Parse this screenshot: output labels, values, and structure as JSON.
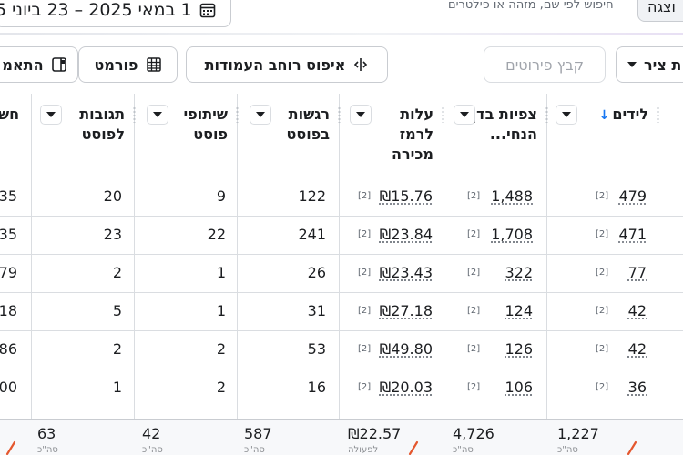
{
  "topbar": {
    "date_range": "1 במאי 2025 – 23 ביוני 5",
    "search_hint": "חיפוש לפי שם, מזהה או פילטרים",
    "display_label": "וצגה"
  },
  "toolbar": {
    "chart_label": "ת ציר",
    "breakdown_label": "קבץ פירוטים",
    "reset_columns_label": "איפוס רוחב העמודות",
    "format_label": "פורמט",
    "more_label": "התאמ"
  },
  "columns": [
    {
      "label": "לידים",
      "sorted": true
    },
    {
      "label": "צפיות בדף הנחי...",
      "sorted": false
    },
    {
      "label": "עלות לרמז מכירה",
      "sorted": false
    },
    {
      "label": "רגשות בפוסט",
      "sorted": false
    },
    {
      "label": "שיתופי פוסט",
      "sorted": false
    },
    {
      "label": "תגובות לפוסט",
      "sorted": false
    },
    {
      "label": "חש",
      "sorted": false
    }
  ],
  "badge_text": "[2]",
  "rows": [
    {
      "leads": "479",
      "views": "1,488",
      "cost": "₪15.76",
      "reactions": "122",
      "shares": "9",
      "comments": "20",
      "edge": "35"
    },
    {
      "leads": "471",
      "views": "1,708",
      "cost": "₪23.84",
      "reactions": "241",
      "shares": "22",
      "comments": "23",
      "edge": "35"
    },
    {
      "leads": "77",
      "views": "322",
      "cost": "₪23.43",
      "reactions": "26",
      "shares": "1",
      "comments": "2",
      "edge": "79"
    },
    {
      "leads": "42",
      "views": "124",
      "cost": "₪27.18",
      "reactions": "31",
      "shares": "1",
      "comments": "5",
      "edge": "18"
    },
    {
      "leads": "42",
      "views": "126",
      "cost": "₪49.80",
      "reactions": "53",
      "shares": "2",
      "comments": "2",
      "edge": "86"
    },
    {
      "leads": "36",
      "views": "106",
      "cost": "₪20.03",
      "reactions": "16",
      "shares": "2",
      "comments": "1",
      "edge": "00"
    }
  ],
  "totals": {
    "leads": "1,227",
    "views": "4,726",
    "cost": "₪22.57",
    "reactions": "587",
    "shares": "42",
    "comments": "63",
    "sub_label": "סה\"כ",
    "cost_sub_label": "לפעולה"
  },
  "colors": {
    "accent": "#1877f2",
    "border": "#dadde1",
    "text": "#1c1e21",
    "pen": "#e4572e"
  }
}
